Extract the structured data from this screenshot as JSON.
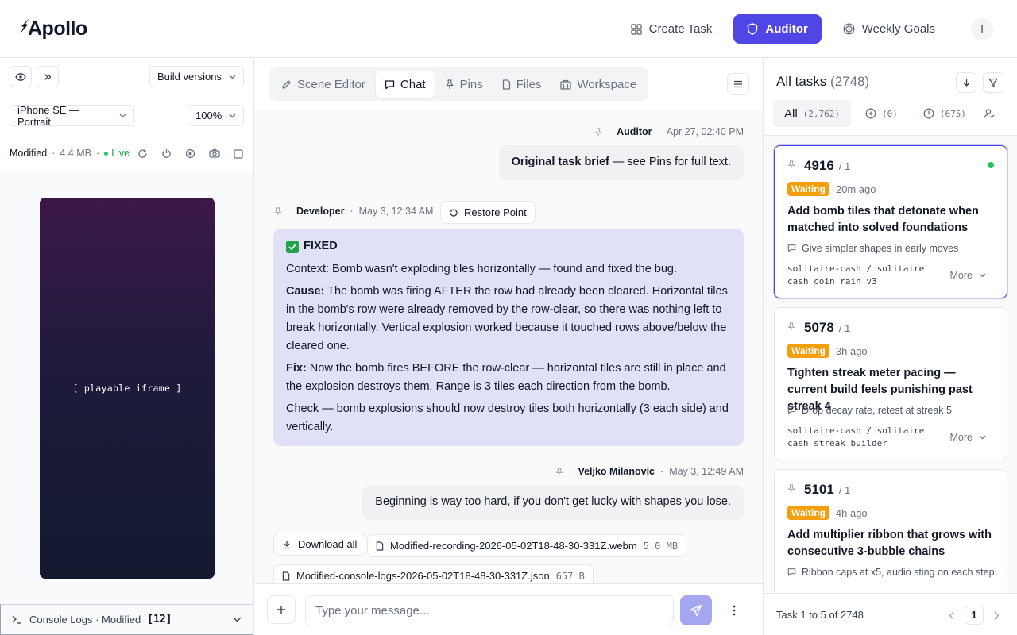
{
  "app": {
    "logo": "Apollo"
  },
  "header": {
    "nav": [
      {
        "label": "Create Task",
        "icon": "grid-icon"
      },
      {
        "label": "Auditor",
        "icon": "shield-icon",
        "active": true
      },
      {
        "label": "Weekly Goals",
        "icon": "target-icon"
      }
    ],
    "avatar": "I"
  },
  "left": {
    "build_versions": "Build versions",
    "device": "iPhone SE — Portrait",
    "zoom": "100%",
    "status": {
      "label": "Modified",
      "size": "4.4 MB",
      "live": "Live"
    },
    "iframe_placeholder": "[ playable iframe ]",
    "console": {
      "label": "Console Logs · Modified",
      "count": "[12]"
    }
  },
  "tabs": [
    {
      "label": "Scene Editor",
      "icon": "pencil-icon"
    },
    {
      "label": "Chat",
      "icon": "chat-icon",
      "active": true
    },
    {
      "label": "Pins",
      "icon": "pin-icon"
    },
    {
      "label": "Files",
      "icon": "file-icon"
    },
    {
      "label": "Workspace",
      "icon": "building-icon"
    }
  ],
  "chat": {
    "msg1": {
      "author": "Auditor",
      "time": "Apr 27, 02:40 PM",
      "bold": "Original task brief",
      "text": " — see Pins for full text."
    },
    "msg2": {
      "author": "Developer",
      "time": "May 3, 12:34 AM",
      "restore": "Restore Point",
      "title": "FIXED",
      "context": "Context: Bomb wasn't exploding tiles horizontally — found and fixed the bug.",
      "cause_label": "Cause:",
      "cause": " The bomb was firing AFTER the row had already been cleared. Horizontal tiles in the bomb's row were already removed by the row-clear, so there was nothing left to break horizontally. Vertical explosion worked because it touched rows above/below the cleared one.",
      "fix_label": "Fix:",
      "fix": " Now the bomb fires BEFORE the row-clear — horizontal tiles are still in place and the explosion destroys them. Range is 3 tiles each direction from the bomb.",
      "check": "Check — bomb explosions should now destroy tiles both horizontally (3 each side) and vertically."
    },
    "msg3": {
      "author": "Veljko Milanovic",
      "time": "May 3, 12:49 AM",
      "text": "Beginning is way too hard, if you don't get lucky with shapes you lose."
    },
    "attachments": {
      "download_all": "Download all",
      "files": [
        {
          "name": "Modified-recording-2026-05-02T18-48-30-331Z.webm",
          "size": "5.0 MB"
        },
        {
          "name": "Modified-console-logs-2026-05-02T18-48-30-331Z.json",
          "size": "657 B"
        }
      ]
    },
    "composer": {
      "placeholder": "Type your message..."
    }
  },
  "tasks": {
    "title": "All tasks",
    "count": "(2748)",
    "filters": [
      {
        "label": "All",
        "count": "(2,762)",
        "active": true
      },
      {
        "label": "",
        "count": "(0)",
        "icon": "circle-plus-icon"
      },
      {
        "label": "",
        "count": "(675)",
        "icon": "clock-icon"
      }
    ],
    "items": [
      {
        "id": "4916",
        "frac": "/ 1",
        "status": "Waiting",
        "age": "20m ago",
        "title": "Add bomb tiles that detonate when matched into solved foundations",
        "note": "Give simpler shapes in early moves",
        "repo": "solitaire-cash / solitaire cash coin rain v3",
        "more": "More",
        "online": true
      },
      {
        "id": "5078",
        "frac": "/ 1",
        "status": "Waiting",
        "age": "3h ago",
        "title": "Tighten streak meter pacing — current build feels punishing past streak 4",
        "note": "Drop decay rate, retest at streak 5",
        "repo": "solitaire-cash / solitaire cash streak builder",
        "more": "More"
      },
      {
        "id": "5101",
        "frac": "/ 1",
        "status": "Waiting",
        "age": "4h ago",
        "title": "Add multiplier ribbon that grows with consecutive 3-bubble chains",
        "note": "Ribbon caps at x5, audio sting on each step",
        "repo": "",
        "more": ""
      }
    ],
    "footer": {
      "info": "Task 1 to 5 of 2748",
      "page": "1"
    }
  },
  "colors": {
    "accent": "#4f46e5",
    "waiting": "#f59e0b",
    "live": "#22c55e"
  }
}
